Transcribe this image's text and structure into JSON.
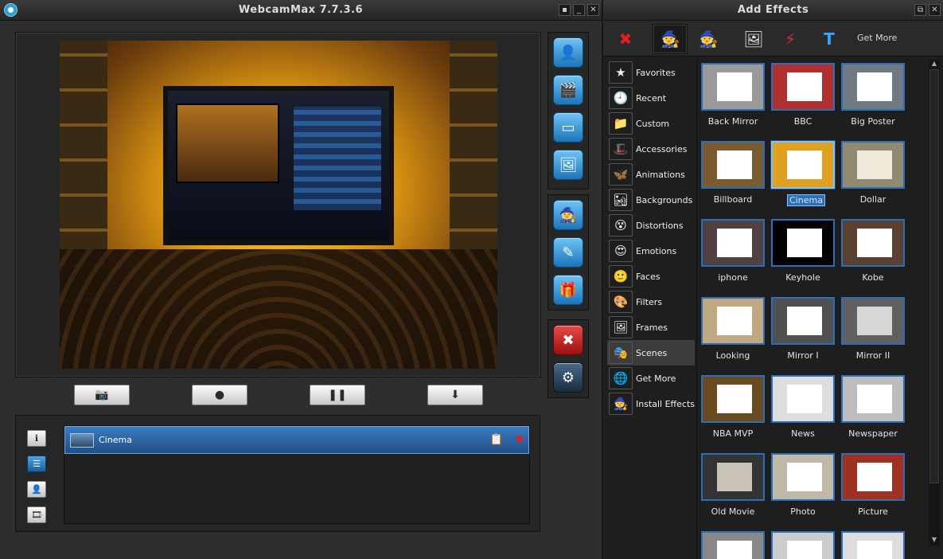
{
  "main_window": {
    "title": "WebcamMax  7.7.3.6",
    "controls": {
      "pin": "▪",
      "minimize": "_",
      "close": "✕"
    }
  },
  "preview": {
    "effect_name": "Cinema",
    "buttons": [
      {
        "name": "snapshot-button",
        "icon": "📷"
      },
      {
        "name": "record-button",
        "icon": "●"
      },
      {
        "name": "pause-button",
        "icon": "❚❚"
      },
      {
        "name": "download-button",
        "icon": "⬇"
      }
    ]
  },
  "side_toolbar": {
    "group1": [
      "👤",
      "🎬",
      "▭",
      "🖼"
    ],
    "group2": [
      "🧙",
      "✎",
      "🎁"
    ],
    "group3": [
      "✖",
      "⚙"
    ]
  },
  "history": {
    "mini_tools": [
      "ℹ",
      "☰",
      "👤",
      "🎞"
    ],
    "items": [
      {
        "name": "Cinema",
        "clipboard_icon": "📋",
        "delete_icon": "✖"
      }
    ]
  },
  "effects_window": {
    "title": "Add Effects",
    "controls": {
      "restore": "⧉",
      "close": "✕"
    },
    "toolbar": {
      "remove_icon": "✖",
      "wizard_icon": "🧙",
      "wizard2_icon": "🧙",
      "add_image_icon": "🖼",
      "add_flash_icon": "⚡",
      "add_text_icon": "T",
      "get_more": "Get More"
    },
    "categories": [
      {
        "label": "Favorites",
        "icon": "★"
      },
      {
        "label": "Recent",
        "icon": "🕘"
      },
      {
        "label": "Custom",
        "icon": "📁"
      },
      {
        "label": "Accessories",
        "icon": "🎩"
      },
      {
        "label": "Animations",
        "icon": "🦋"
      },
      {
        "label": "Backgrounds",
        "icon": "🏜"
      },
      {
        "label": "Distortions",
        "icon": "😵"
      },
      {
        "label": "Emotions",
        "icon": "😍"
      },
      {
        "label": "Faces",
        "icon": "🙂"
      },
      {
        "label": "Filters",
        "icon": "🎨"
      },
      {
        "label": "Frames",
        "icon": "🖼"
      },
      {
        "label": "Scenes",
        "icon": "🎭"
      },
      {
        "label": "Get More",
        "icon": "🌐"
      },
      {
        "label": "Install Effects",
        "icon": "🧙"
      }
    ],
    "selected_category": "Scenes",
    "thumbnails": [
      {
        "label": "Back Mirror",
        "bg": "#9a9a9a",
        "inner": "#ffffff"
      },
      {
        "label": "BBC",
        "bg": "#b03030",
        "inner": "#ffffff"
      },
      {
        "label": "Big Poster",
        "bg": "#6f7a85",
        "inner": "#ffffff"
      },
      {
        "label": "Billboard",
        "bg": "#7a5a30",
        "inner": "#ffffff"
      },
      {
        "label": "Cinema",
        "bg": "#e0a020",
        "inner": "#ffffff"
      },
      {
        "label": "Dollar",
        "bg": "#8f8a70",
        "inner": "#f1eadc"
      },
      {
        "label": "iphone",
        "bg": "#504040",
        "inner": "#ffffff"
      },
      {
        "label": "Keyhole",
        "bg": "#000000",
        "inner": "#ffffff"
      },
      {
        "label": "Kobe",
        "bg": "#5a4030",
        "inner": "#ffffff"
      },
      {
        "label": "Looking",
        "bg": "#c0a880",
        "inner": "#ffffff"
      },
      {
        "label": "Mirror I",
        "bg": "#505050",
        "inner": "#ffffff"
      },
      {
        "label": "Mirror II",
        "bg": "#606060",
        "inner": "#d8d8d8"
      },
      {
        "label": "NBA MVP",
        "bg": "#6a4a20",
        "inner": "#ffffff"
      },
      {
        "label": "News",
        "bg": "#dddddd",
        "inner": "#ffffff"
      },
      {
        "label": "Newspaper",
        "bg": "#bdbdbd",
        "inner": "#ffffff"
      },
      {
        "label": "Old Movie",
        "bg": "#333333",
        "inner": "#c8c2b8"
      },
      {
        "label": "Photo",
        "bg": "#c0b8a8",
        "inner": "#ffffff"
      },
      {
        "label": "Picture",
        "bg": "#a03020",
        "inner": "#ffffff"
      },
      {
        "label": "",
        "bg": "#888888",
        "inner": "#ffffff"
      },
      {
        "label": "",
        "bg": "#cccccc",
        "inner": "#ffffff"
      },
      {
        "label": "",
        "bg": "#dddddd",
        "inner": "#ffffff"
      }
    ],
    "selected_thumbnail": "Cinema",
    "scroll": {
      "up": "▲",
      "down": "▼"
    }
  },
  "colors": {
    "accent": "#2a6fb8",
    "selection": "#3a7bc1",
    "danger": "#c81818"
  }
}
